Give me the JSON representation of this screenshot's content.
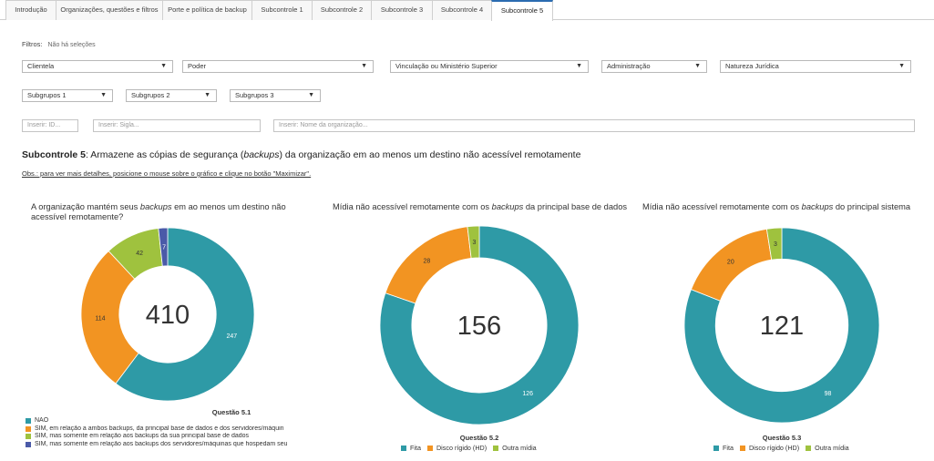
{
  "tabs": [
    {
      "label": "Introdução",
      "active": false
    },
    {
      "label": "Organizações, questões e filtros",
      "active": false
    },
    {
      "label": "Porte e política de backup",
      "active": false
    },
    {
      "label": "Subcontrole 1",
      "active": false
    },
    {
      "label": "Subcontrole 2",
      "active": false
    },
    {
      "label": "Subcontrole 3",
      "active": false
    },
    {
      "label": "Subcontrole 4",
      "active": false
    },
    {
      "label": "Subcontrole 5",
      "active": true
    }
  ],
  "filters": {
    "label": "Filtros:",
    "value": "Não há seleções",
    "row1": [
      "Clientela",
      "Poder",
      "Vinculação ou Ministério Superior",
      "Administração",
      "Natureza Jurídica"
    ],
    "row2": [
      "Subgrupos 1",
      "Subgrupos 2",
      "Subgrupos 3"
    ],
    "inputs": {
      "id_placeholder": "Inserir: ID...",
      "sigla_placeholder": "Inserir: Sigla...",
      "nome_placeholder": "Inserir: Nome da organização..."
    }
  },
  "heading": {
    "bold": "Subcontrole 5",
    "text_before": ": Armazene as cópias de segurança (",
    "italic": "backups",
    "text_after": ") da organização em ao menos um destino não acessível remotamente"
  },
  "obs": "Obs.: para ver mais detalhes, posicione o mouse sobre o gráfico e clique no botão \"Maximizar\".",
  "colors": {
    "teal": "#2e9aa6",
    "orange": "#f29422",
    "green": "#9fc23e",
    "navy": "#4a5aa8"
  },
  "chart_data": [
    {
      "type": "pie",
      "title_parts": [
        "A organização mantém seus ",
        "backups",
        " em ao menos um destino não acessível remotamente?"
      ],
      "center_total": "410",
      "question_label": "Questão 5.1",
      "slices": [
        {
          "label": "NÃO",
          "legend": "NÃO",
          "value": 247,
          "color": "#2e9aa6"
        },
        {
          "label": "SIM, em relação a ambos backups",
          "legend": "SIM, em relação a ambos backups, da principal base de dados e dos servidores/máquin",
          "value": 114,
          "color": "#f29422"
        },
        {
          "label": "SIM, base de dados",
          "legend": "SIM, mas somente em relação aos backups da sua principal base de dados",
          "value": 42,
          "color": "#9fc23e"
        },
        {
          "label": "SIM, servidores/máquinas",
          "legend": "SIM, mas somente em relação aos backups dos servidores/máquinas que hospedam seu",
          "value": 7,
          "color": "#4a5aa8"
        }
      ],
      "legend_placement": "bottom-left"
    },
    {
      "type": "pie",
      "title_parts": [
        "Mídia não acessível remotamente com os ",
        "backups",
        " da principal base de dados"
      ],
      "center_total": "156",
      "question_label": "Questão 5.2",
      "slices": [
        {
          "legend": "Fita",
          "value": 126,
          "color": "#2e9aa6"
        },
        {
          "legend": "Disco rígido (HD)",
          "value": 28,
          "color": "#f29422"
        },
        {
          "legend": "Outra mídia",
          "value": 3,
          "color": "#9fc23e"
        }
      ],
      "legend_placement": "bottom"
    },
    {
      "type": "pie",
      "title_parts": [
        "Mídia não acessível remotamente com os ",
        "backups",
        " do principal sistema"
      ],
      "center_total": "121",
      "question_label": "Questão 5.3",
      "slices": [
        {
          "legend": "Fita",
          "value": 98,
          "color": "#2e9aa6"
        },
        {
          "legend": "Disco rígido (HD)",
          "value": 20,
          "color": "#f29422"
        },
        {
          "legend": "Outra mídia",
          "value": 3,
          "color": "#9fc23e"
        }
      ],
      "legend_placement": "bottom"
    }
  ]
}
